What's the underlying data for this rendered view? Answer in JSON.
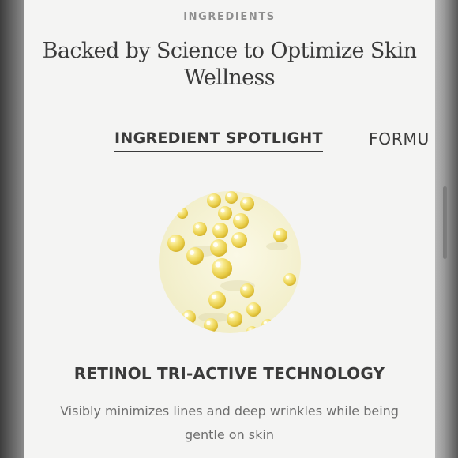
{
  "section": {
    "eyebrow": "INGREDIENTS",
    "headline": "Backed by Science to Optimize Skin Wellness"
  },
  "tabs": [
    {
      "label": "INGREDIENT SPOTLIGHT",
      "active": true
    },
    {
      "label": "FORMU",
      "active": false
    }
  ],
  "spotlight": {
    "image_icon": "retinol-beads-icon",
    "title": "RETINOL TRI-ACTIVE TECHNOLOGY",
    "description": "Visibly minimizes lines and deep wrinkles while being gentle on skin"
  },
  "colors": {
    "page_background": "#f4f4f3",
    "heading_text": "#3a3a3a",
    "muted_text": "#8f8f8f",
    "bead_yellow": "#f3e27a",
    "image_background": "#f8f5d8"
  }
}
